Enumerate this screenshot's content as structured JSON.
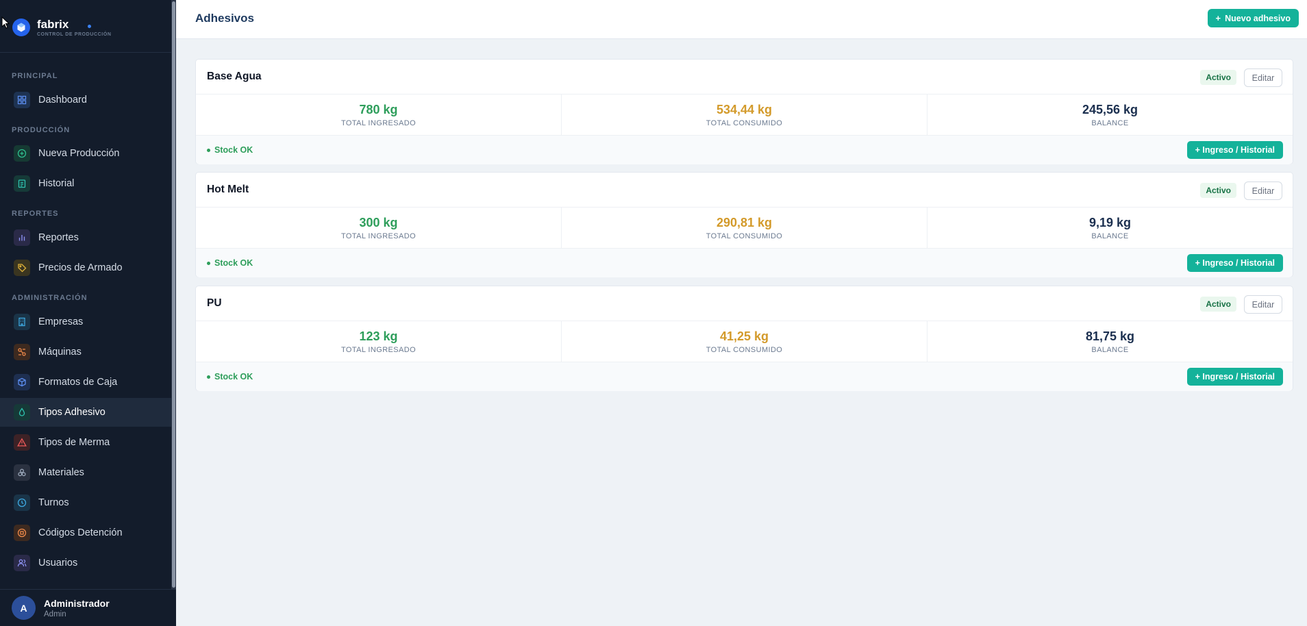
{
  "app": {
    "name": "fabrix",
    "subtitle": "CONTROL DE PRODUCCIÓN"
  },
  "sidebar": {
    "sections": {
      "principal": "PRINCIPAL",
      "produccion": "PRODUCCIÓN",
      "reportes": "REPORTES",
      "administracion": "ADMINISTRACIÓN"
    },
    "items": [
      {
        "label": "Dashboard",
        "icon": "grid-icon"
      },
      {
        "label": "Nueva Producción",
        "icon": "plus-circle-icon"
      },
      {
        "label": "Historial",
        "icon": "clipboard-icon"
      },
      {
        "label": "Reportes",
        "icon": "bar-chart-icon"
      },
      {
        "label": "Precios de Armado",
        "icon": "tag-icon"
      },
      {
        "label": "Empresas",
        "icon": "building-icon"
      },
      {
        "label": "Máquinas",
        "icon": "machine-icon"
      },
      {
        "label": "Formatos de Caja",
        "icon": "box-icon"
      },
      {
        "label": "Tipos Adhesivo",
        "icon": "droplet-icon",
        "active": true
      },
      {
        "label": "Tipos de Merma",
        "icon": "warning-icon"
      },
      {
        "label": "Materiales",
        "icon": "layers-icon"
      },
      {
        "label": "Turnos",
        "icon": "clock-icon"
      },
      {
        "label": "Códigos Detención",
        "icon": "stop-circle-icon"
      },
      {
        "label": "Usuarios",
        "icon": "users-icon"
      }
    ]
  },
  "user": {
    "initial": "A",
    "name": "Administrador",
    "role": "Admin"
  },
  "header": {
    "title": "Adhesivos",
    "new_button": "Nuevo adhesivo"
  },
  "labels": {
    "total_ingresado": "TOTAL INGRESADO",
    "total_consumido": "TOTAL CONSUMIDO",
    "balance": "BALANCE",
    "edit": "Editar",
    "ingreso": "+ Ingreso / Historial"
  },
  "adhesivos": [
    {
      "name": "Base Agua",
      "status": "Activo",
      "ingresado": "780 kg",
      "consumido": "534,44 kg",
      "balance": "245,56 kg",
      "stock": "Stock OK"
    },
    {
      "name": "Hot Melt",
      "status": "Activo",
      "ingresado": "300 kg",
      "consumido": "290,81 kg",
      "balance": "9,19 kg",
      "stock": "Stock OK"
    },
    {
      "name": "PU",
      "status": "Activo",
      "ingresado": "123 kg",
      "consumido": "41,25 kg",
      "balance": "81,75 kg",
      "stock": "Stock OK"
    }
  ],
  "colors": {
    "accent": "#14b29a",
    "sidebar_bg": "#131c2b",
    "ingresado": "#2e9e5b",
    "consumido": "#d39a2a",
    "balance": "#1b2f4f"
  }
}
